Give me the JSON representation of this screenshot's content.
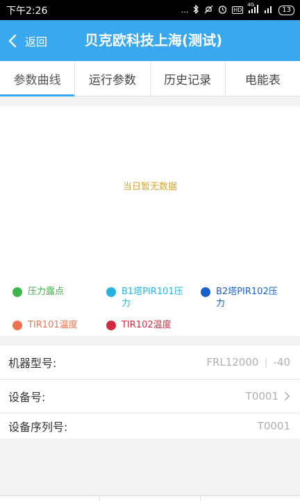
{
  "status_bar": {
    "time": "下午2:26",
    "dots": "...",
    "network_label": "HD",
    "network_type": "4G",
    "battery": "13"
  },
  "header": {
    "back_label": "返回",
    "title": "贝克欧科技上海(测试)",
    "color": "#3aa8ee"
  },
  "tabs": [
    {
      "label": "参数曲线",
      "active": true
    },
    {
      "label": "运行参数",
      "active": false
    },
    {
      "label": "历史记录",
      "active": false
    },
    {
      "label": "电能表",
      "active": false
    }
  ],
  "chart": {
    "empty_text": "当日暂无数据",
    "legend": [
      {
        "label": "压力露点",
        "color": "#3db54a"
      },
      {
        "label": "B1塔PIR101压力",
        "color": "#23b5e0"
      },
      {
        "label": "B2塔PIR102压力",
        "color": "#1a5fc9"
      },
      {
        "label": "TIR101温度",
        "color": "#ee7350"
      },
      {
        "label": "TIR102温度",
        "color": "#d42a3f"
      }
    ]
  },
  "info": {
    "model_label": "机器型号:",
    "model_value": "FRL12000",
    "model_suffix": "-40",
    "device_no_label": "设备号:",
    "device_no_value": "T0001",
    "serial_label": "设备序列号:",
    "serial_value": "T0001"
  }
}
